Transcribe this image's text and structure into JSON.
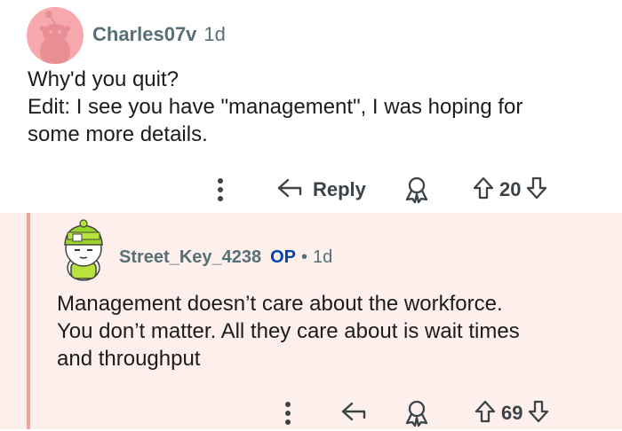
{
  "comment": {
    "username": "Charles07v",
    "age": "1d",
    "body_lines": [
      "Why'd you quit?",
      "Edit: I see you have \"management\", I was hoping for",
      "some more details."
    ],
    "actions": {
      "reply_label": "Reply",
      "vote_count": "20"
    }
  },
  "reply": {
    "username": "Street_Key_4238",
    "op_badge": "OP",
    "separator": "•",
    "age": "1d",
    "body_lines": [
      "Management doesn’t care about the workforce.",
      "You don’t matter. All they care about is wait times",
      "and throughput"
    ],
    "actions": {
      "vote_count": "69"
    }
  },
  "colors": {
    "reply_background": "#fdf0ec",
    "thread_line": "#f0a39a",
    "op_badge": "#0045ac",
    "avatar_background": "#f7a8ad"
  },
  "icons": [
    "more-options-icon",
    "reply-arrow-icon",
    "award-icon",
    "upvote-icon",
    "downvote-icon"
  ]
}
